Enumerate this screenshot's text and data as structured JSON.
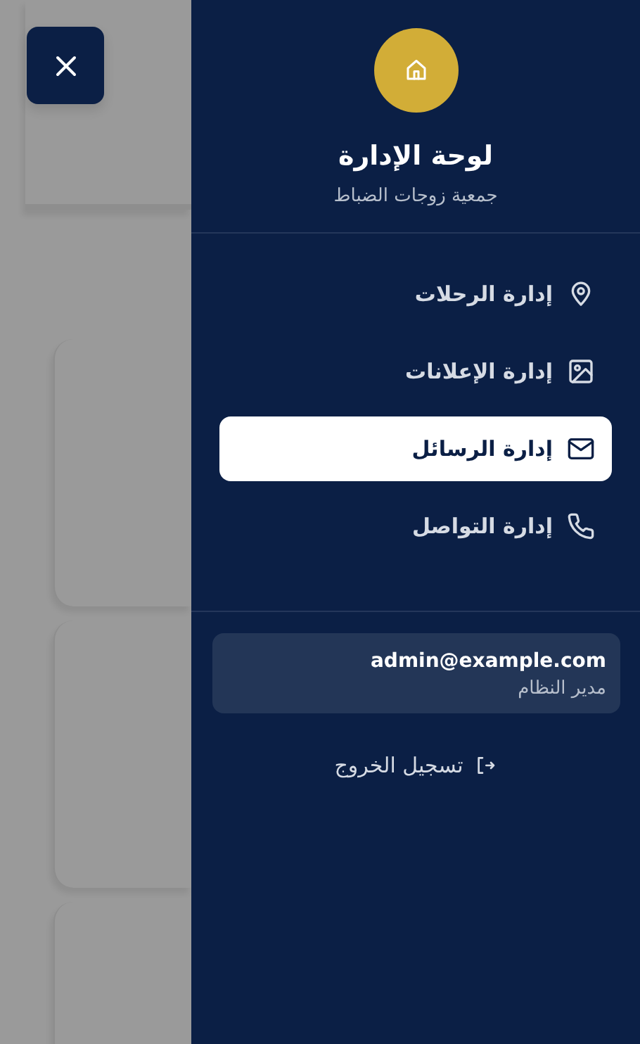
{
  "sidebar": {
    "title": "لوحة الإدارة",
    "subtitle": "جمعية زوجات الضباط",
    "items": [
      {
        "label": "إدارة الرحلات",
        "selected": false
      },
      {
        "label": "إدارة الإعلانات",
        "selected": false
      },
      {
        "label": "إدارة الرسائل",
        "selected": true
      },
      {
        "label": "إدارة التواصل",
        "selected": false
      }
    ],
    "user": {
      "email": "admin@example.com",
      "role": "مدير النظام"
    },
    "logout": "تسجيل الخروج"
  }
}
